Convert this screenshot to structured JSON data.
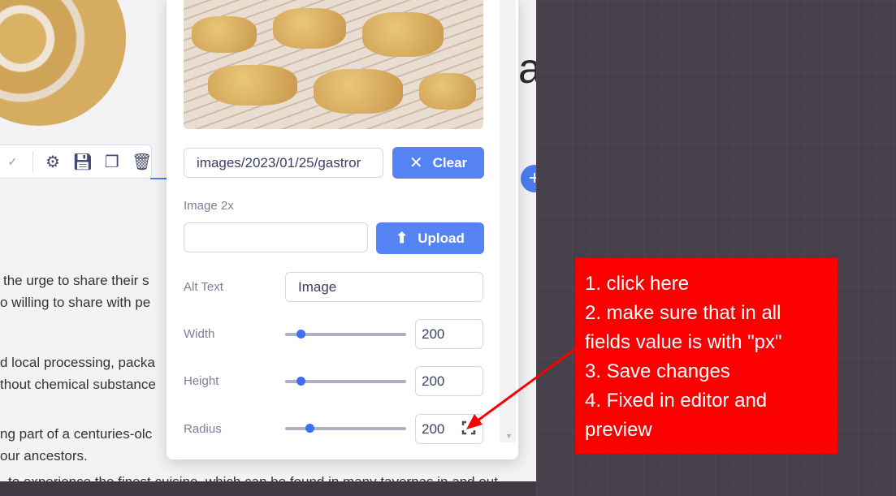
{
  "editor": {
    "headline_fragment": "a",
    "toolbar": {
      "icons": [
        "chevron-down-icon",
        "gear-icon",
        "save-icon",
        "duplicate-icon",
        "trash-icon"
      ]
    },
    "paragraphs": [
      "the urge to share their s",
      "o willing to share with pe",
      "d local processing, packa",
      "thout chemical substance",
      "ng part of a centuries-olc",
      "our ancestors.",
      "to experience the finest cuisine, which can be found in many tavernas in and out"
    ]
  },
  "panel": {
    "image_path": "images/2023/01/25/gastror",
    "clear_label": "Clear",
    "image2x_label": "Image 2x",
    "image2x_value": "",
    "upload_label": "Upload",
    "alt_label": "Alt Text",
    "alt_value": "Image",
    "width_label": "Width",
    "width_value": "200",
    "height_label": "Height",
    "height_value": "200",
    "radius_label": "Radius",
    "radius_value": "200",
    "sliders": {
      "width": 0.13,
      "height": 0.13,
      "radius": 0.2
    }
  },
  "annotation": {
    "lines": [
      "1. click here",
      "2. make sure that in all fields value is with \"px\"",
      "3. Save changes",
      "4. Fixed in editor and preview"
    ],
    "color": "#fb0000"
  },
  "colors": {
    "accent": "#5683f3",
    "dark_bg": "#46404b"
  }
}
